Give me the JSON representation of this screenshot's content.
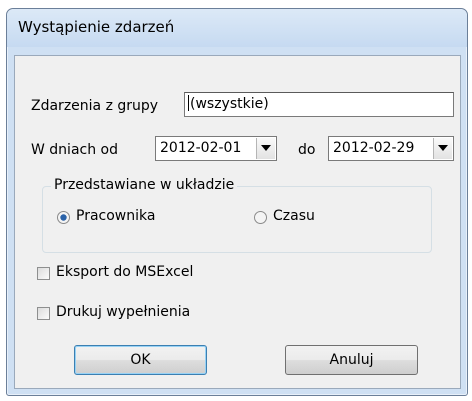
{
  "window": {
    "title": "Wystąpienie zdarzeń"
  },
  "group_filter": {
    "label": "Zdarzenia z grupy",
    "value": "(wszystkie)"
  },
  "date_range": {
    "from_label": "W dniach od",
    "from_value": "2012-02-01",
    "to_label": "do",
    "to_value": "2012-02-29"
  },
  "layout_group": {
    "legend": "Przedstawiane w układzie",
    "options": [
      {
        "label": "Pracownika",
        "selected": true
      },
      {
        "label": "Czasu",
        "selected": false
      }
    ]
  },
  "checkboxes": [
    {
      "label": "Eksport do MSExcel",
      "checked": false
    },
    {
      "label": "Drukuj wypełnienia",
      "checked": false
    }
  ],
  "buttons": {
    "ok": "OK",
    "cancel": "Anuluj"
  },
  "colors": {
    "accent": "#3c7fb1",
    "titlebar": "#cfe0f3"
  }
}
